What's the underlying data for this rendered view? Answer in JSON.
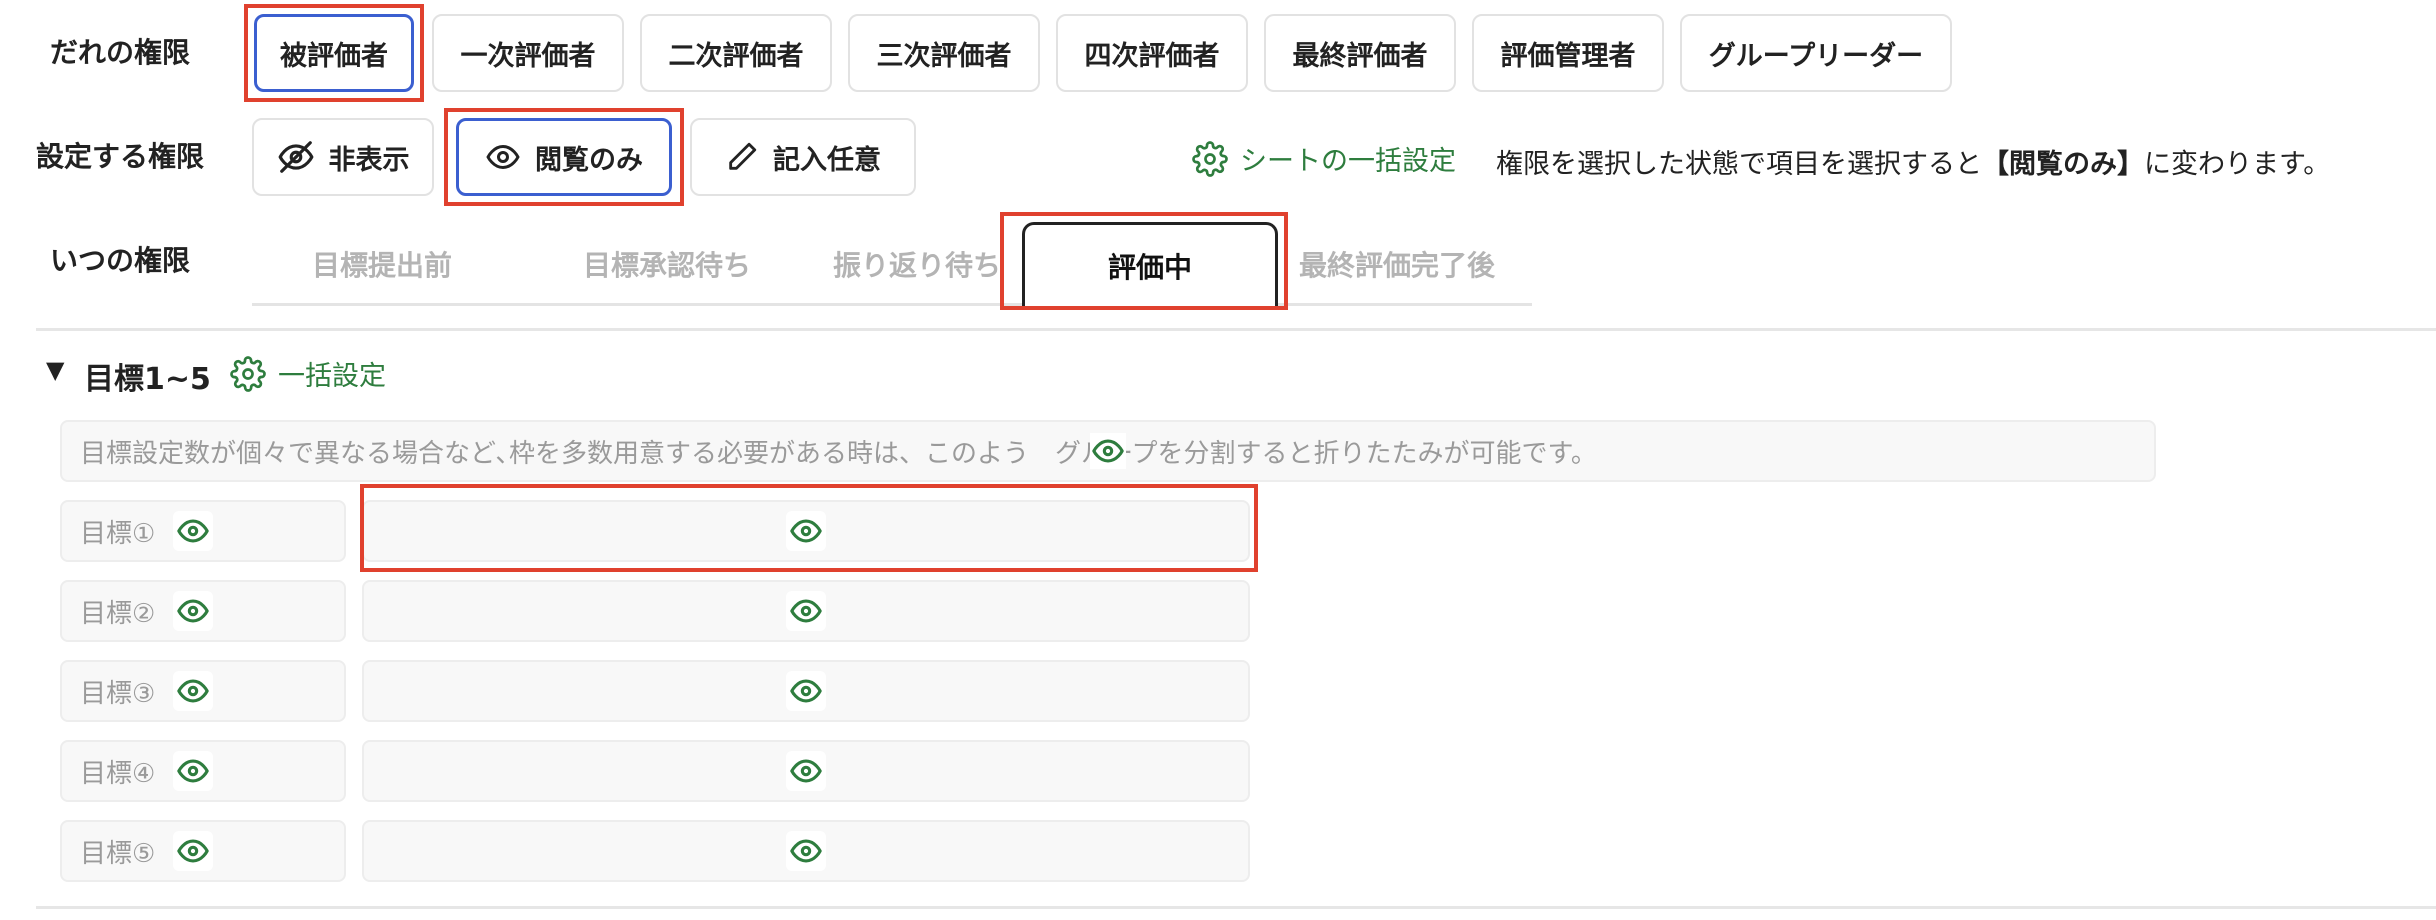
{
  "who": {
    "label": "だれの権限",
    "roles": [
      "被評価者",
      "一次評価者",
      "二次評価者",
      "三次評価者",
      "四次評価者",
      "最終評価者",
      "評価管理者",
      "グループリーダー"
    ],
    "selected": "被評価者"
  },
  "setting": {
    "label": "設定する権限",
    "options": [
      {
        "label": "非表示",
        "icon": "eye-off-icon"
      },
      {
        "label": "閲覧のみ",
        "icon": "eye-icon"
      },
      {
        "label": "記入任意",
        "icon": "pencil-icon"
      }
    ],
    "selected": "閲覧のみ",
    "bulk_sheet_label": "シートの一括設定",
    "hint_prefix": "権限を選択した状態で項目を選択すると",
    "hint_bold": "【閲覧のみ】",
    "hint_suffix": "に変わります。"
  },
  "when": {
    "label": "いつの権限",
    "tabs": [
      "目標提出前",
      "目標承認待ち",
      "振り返り待ち",
      "評価中",
      "最終評価完了後"
    ],
    "active": "評価中"
  },
  "section": {
    "toggle_glyph": "▼",
    "title": "目標1~5",
    "bulk_label": "一括設定",
    "note": "目標設定数が個々で異なる場合など､枠を多数用意する必要がある時は、このよう　グループを分割すると折りたたみが可能です。",
    "goals": [
      "目標①",
      "目標②",
      "目標③",
      "目標④",
      "目標⑤"
    ],
    "field_permission_icon": "eye-icon"
  },
  "colors": {
    "accent_green": "#2e7d3e",
    "selected_border": "#3b5fd0",
    "highlight_red": "#e0412e"
  }
}
